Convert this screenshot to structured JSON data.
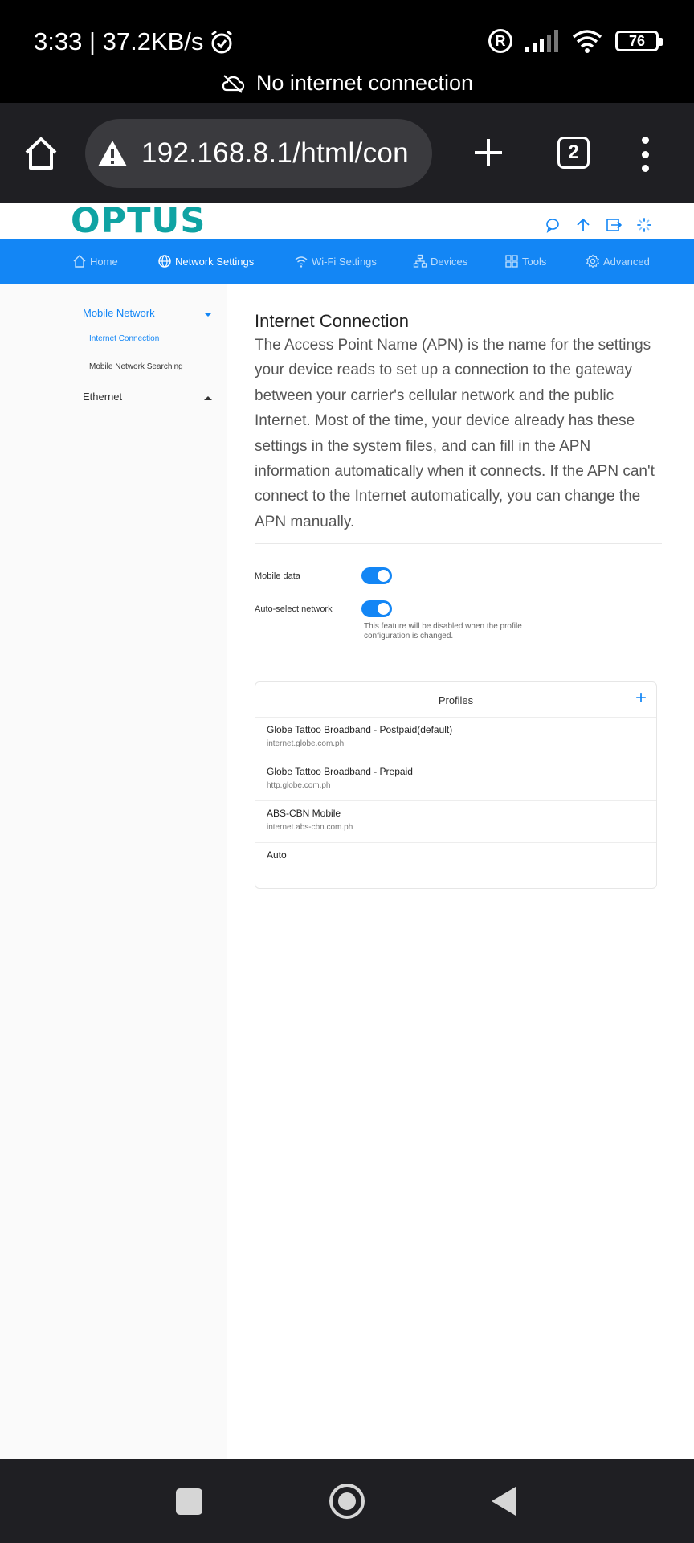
{
  "status_bar": {
    "time_speed": "3:33 | 37.2KB/s",
    "battery": "76",
    "offline_text": "No internet connection"
  },
  "browser": {
    "url": "192.168.8.1/html/con",
    "tab_count": "2"
  },
  "brand": {
    "logo": "OPTUS",
    "logo_color": "#0fa3a3",
    "accent": "#1386f5"
  },
  "nav": {
    "home": "Home",
    "network_settings": "Network Settings",
    "wifi_settings": "Wi-Fi Settings",
    "devices": "Devices",
    "tools": "Tools",
    "advanced": "Advanced"
  },
  "sidebar": {
    "mobile_network": "Mobile Network",
    "internet_connection": "Internet Connection",
    "mobile_network_searching": "Mobile Network Searching",
    "ethernet": "Ethernet"
  },
  "content": {
    "title": "Internet Connection",
    "description": "The Access Point Name (APN) is the name for the settings your device reads to set up a connection to the gateway between your carrier's cellular network and the public Internet. Most of the time, your device already has these settings in the system files, and can fill in the APN information automatically when it connects. If the APN can't connect to the Internet automatically, you can change the APN manually.",
    "mobile_data_label": "Mobile data",
    "auto_select_label": "Auto-select network",
    "auto_select_hint": "This feature will be disabled when the profile configuration is changed."
  },
  "profiles": {
    "title": "Profiles",
    "items": [
      {
        "name": "Globe Tattoo Broadband - Postpaid(default)",
        "apn": "internet.globe.com.ph"
      },
      {
        "name": "Globe Tattoo Broadband - Prepaid",
        "apn": "http.globe.com.ph"
      },
      {
        "name": "ABS-CBN Mobile",
        "apn": "internet.abs-cbn.com.ph"
      },
      {
        "name": "Auto",
        "apn": ""
      }
    ]
  }
}
